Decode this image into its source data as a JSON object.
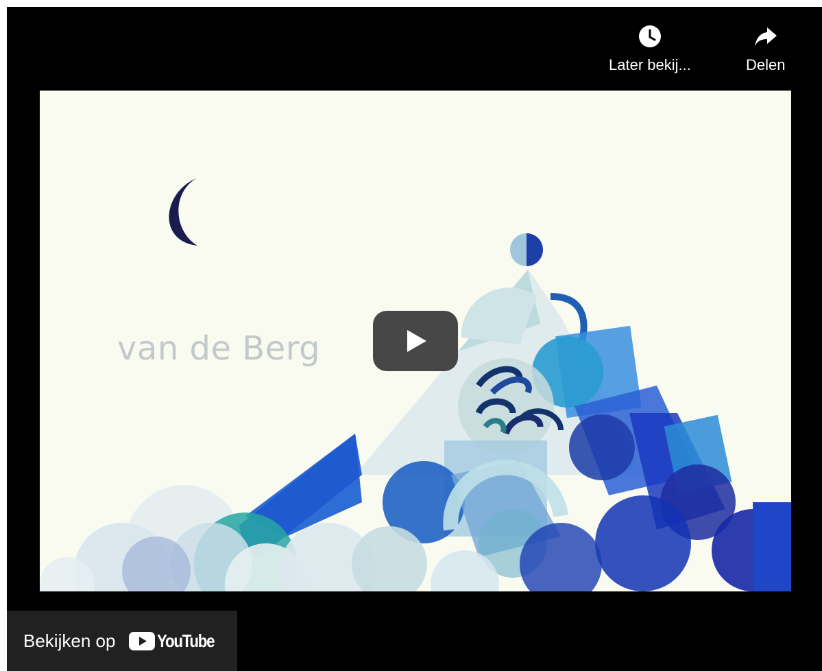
{
  "player": {
    "watch_later_label": "Later bekij...",
    "share_label": "Delen",
    "watch_on_label": "Bekijken op",
    "youtube_wordmark": "YouTube",
    "video_text": "van de Berg"
  },
  "icons": {
    "watch_later": "clock-icon",
    "share": "share-arrow-icon",
    "play": "play-icon",
    "youtube": "youtube-logo-icon"
  },
  "colors": {
    "player_bg": "#000000",
    "watch_bar_bg": "#212121",
    "play_button": "#3d3d3d",
    "youtube_red": "#ffffff",
    "video_bg": "#f9faf0"
  }
}
